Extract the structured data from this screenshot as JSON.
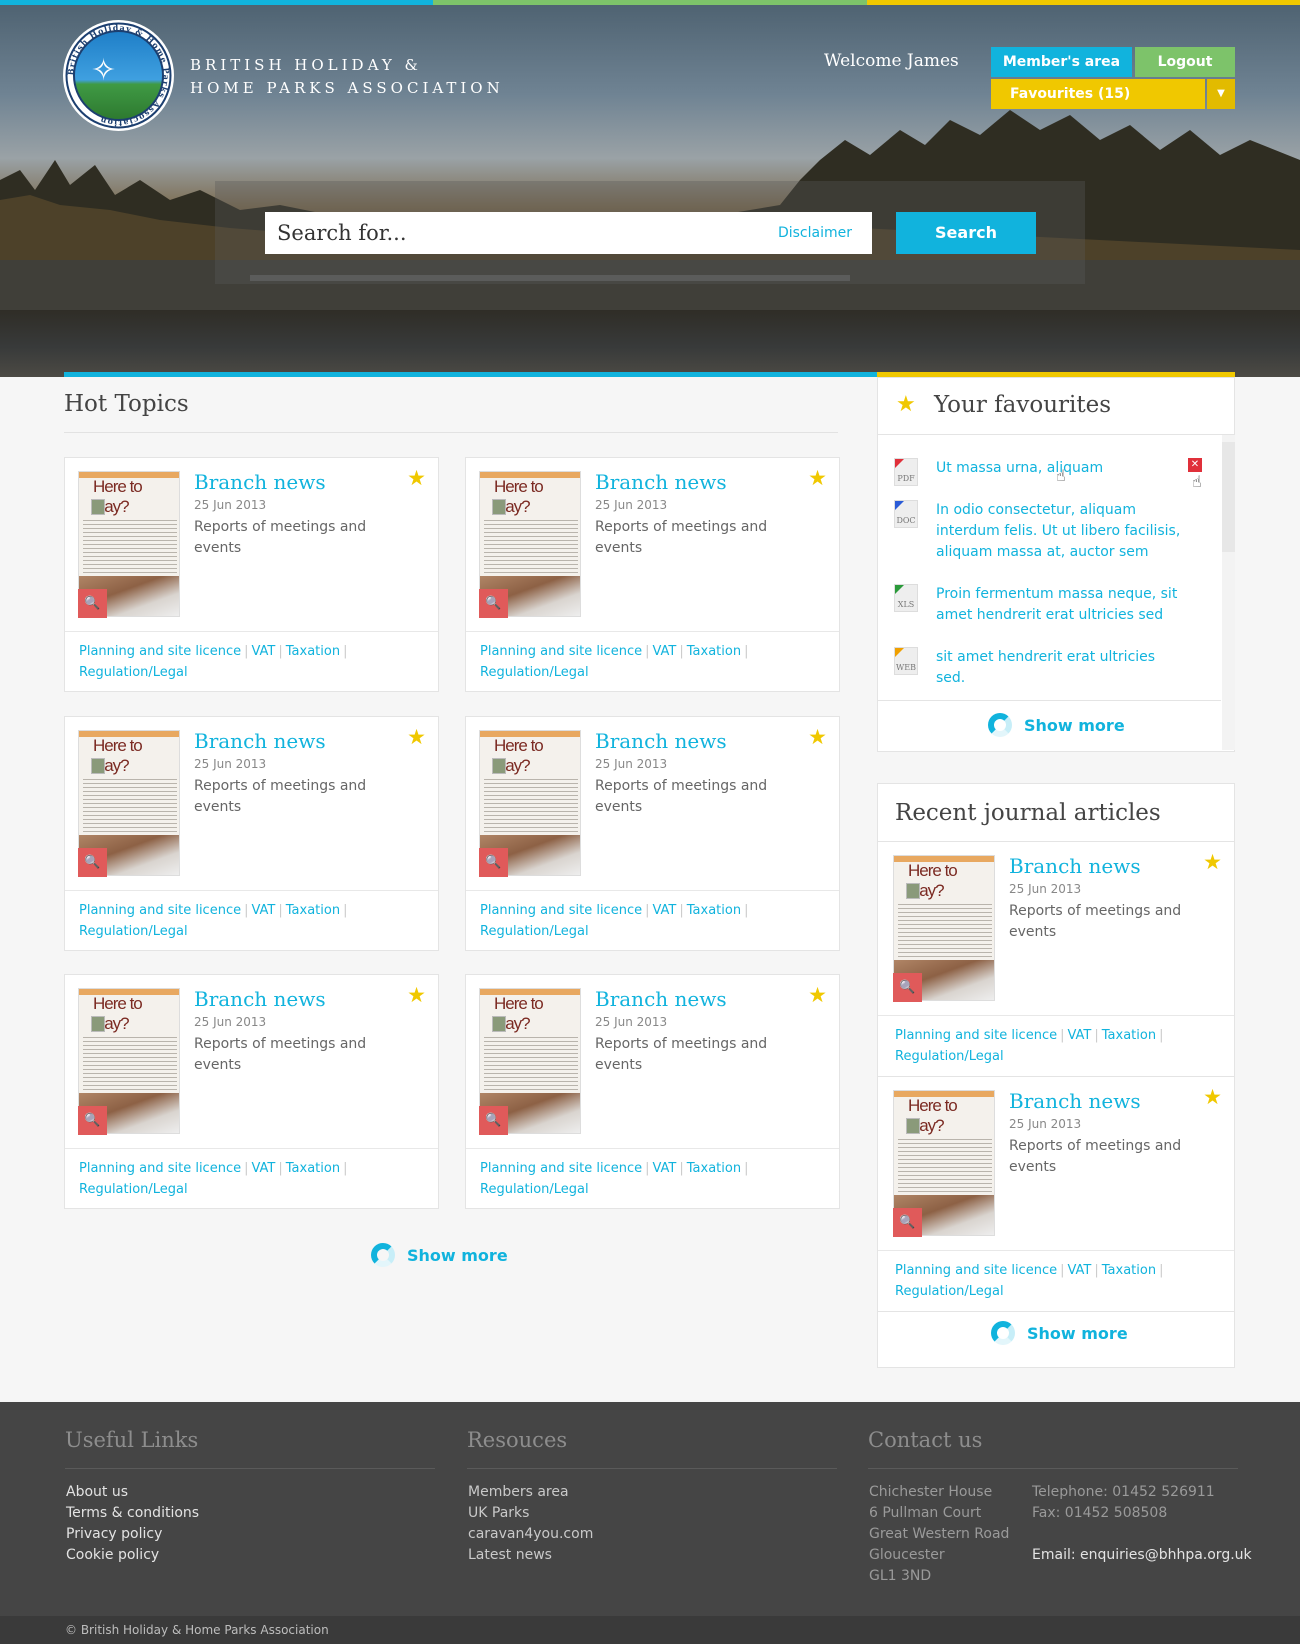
{
  "header": {
    "org_name_line1": "BRITISH HOLIDAY &",
    "org_name_line2": "HOME PARKS ASSOCIATION",
    "logo_text": "British Holiday & Home Parks Association",
    "welcome": "Welcome James",
    "member_area_label": "Member's area",
    "logout_label": "Logout",
    "favourites_label": "Favourites (15)"
  },
  "search": {
    "placeholder": "Search for...",
    "disclaimer": "Disclaimer",
    "button": "Search"
  },
  "colors": {
    "blue": "#11b3dd",
    "green": "#7dc36a",
    "yellow": "#f0c800",
    "red": "#e05a5a"
  },
  "hot_topics": {
    "title": "Hot Topics",
    "cards": [
      {
        "title": "Branch news",
        "date": "25 Jun 2013",
        "desc": "Reports of meetings and events",
        "thumb_title": "Here to stay?",
        "tags": [
          "Planning and site licence",
          "VAT",
          "Taxation",
          "Regulation/Legal"
        ]
      },
      {
        "title": "Branch news",
        "date": "25 Jun 2013",
        "desc": "Reports of meetings and events",
        "thumb_title": "Here to stay?",
        "tags": [
          "Planning and site licence",
          "VAT",
          "Taxation",
          "Regulation/Legal"
        ]
      },
      {
        "title": "Branch news",
        "date": "25 Jun 2013",
        "desc": "Reports of meetings and events",
        "thumb_title": "Here to stay?",
        "tags": [
          "Planning and site licence",
          "VAT",
          "Taxation",
          "Regulation/Legal"
        ]
      },
      {
        "title": "Branch news",
        "date": "25 Jun 2013",
        "desc": "Reports of meetings and events",
        "thumb_title": "Here to stay?",
        "tags": [
          "Planning and site licence",
          "VAT",
          "Taxation",
          "Regulation/Legal"
        ]
      },
      {
        "title": "Branch news",
        "date": "25 Jun 2013",
        "desc": "Reports of meetings and events",
        "thumb_title": "Here to stay?",
        "tags": [
          "Planning and site licence",
          "VAT",
          "Taxation",
          "Regulation/Legal"
        ]
      },
      {
        "title": "Branch news",
        "date": "25 Jun 2013",
        "desc": "Reports of meetings and events",
        "thumb_title": "Here to stay?",
        "tags": [
          "Planning and site licence",
          "VAT",
          "Taxation",
          "Regulation/Legal"
        ]
      }
    ],
    "show_more": "Show more"
  },
  "favourites": {
    "title": "Your favourites",
    "items": [
      {
        "type": "PDF",
        "text": "Ut massa urna, aliquam",
        "color": "#e0303a"
      },
      {
        "type": "DOC",
        "text": "In odio consectetur, aliquam interdum felis. Ut ut libero facilisis, aliquam massa at, auctor sem",
        "color": "#2a5bd7"
      },
      {
        "type": "XLS",
        "text": "Proin fermentum massa neque, sit amet hendrerit erat ultricies sed",
        "color": "#2a9a3a"
      },
      {
        "type": "WEB",
        "text": "sit amet hendrerit erat ultricies sed.",
        "color": "#f0a000"
      }
    ],
    "show_more": "Show more"
  },
  "recent_journal": {
    "title": "Recent journal articles",
    "cards": [
      {
        "title": "Branch news",
        "date": "25 Jun 2013",
        "desc": "Reports of meetings and events",
        "thumb_title": "Here to stay?",
        "tags": [
          "Planning and site licence",
          "VAT",
          "Taxation",
          "Regulation/Legal"
        ]
      },
      {
        "title": "Branch news",
        "date": "25 Jun 2013",
        "desc": "Reports of meetings and events",
        "thumb_title": "Here to stay?",
        "tags": [
          "Planning and site licence",
          "VAT",
          "Taxation",
          "Regulation/Legal"
        ]
      }
    ],
    "show_more": "Show more"
  },
  "footer": {
    "useful_links": {
      "title": "Useful Links",
      "items": [
        "About us",
        "Terms & conditions",
        "Privacy policy",
        "Cookie policy"
      ]
    },
    "resources": {
      "title": "Resouces",
      "items": [
        "Members area",
        "UK Parks",
        "caravan4you.com",
        "Latest news"
      ]
    },
    "contact": {
      "title": "Contact us",
      "address": [
        "Chichester House",
        "6 Pullman Court",
        "Great Western Road",
        "Gloucester",
        "GL1 3ND"
      ],
      "telephone": "Telephone: 01452 526911",
      "fax": "Fax: 01452 508508",
      "email": "Email: enquiries@bhhpa.org.uk"
    },
    "copyright": "© British Holiday & Home Parks Association"
  }
}
